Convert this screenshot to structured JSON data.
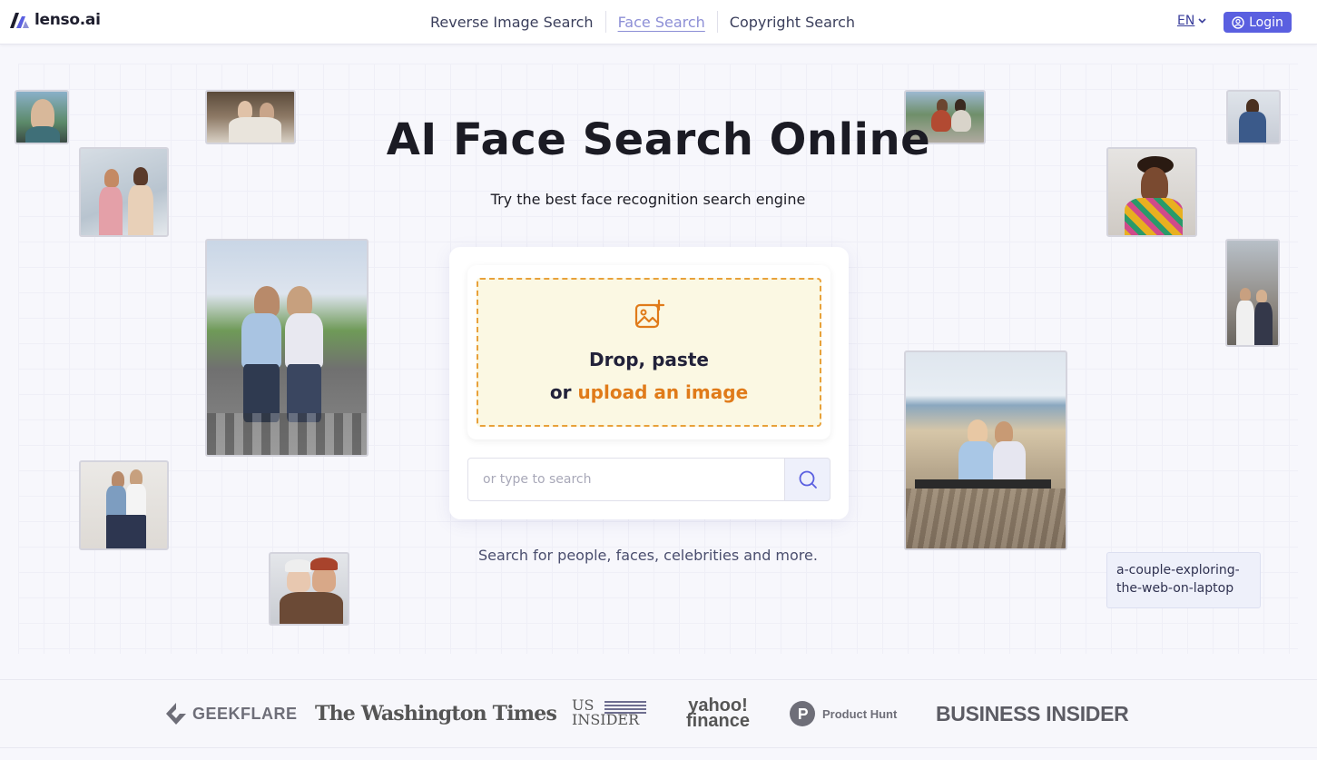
{
  "header": {
    "brand": "lenso.ai",
    "nav": [
      {
        "label": "Reverse Image Search",
        "active": false
      },
      {
        "label": "Face Search",
        "active": true
      },
      {
        "label": "Copyright Search",
        "active": false
      }
    ],
    "language": "EN",
    "login_label": "Login",
    "accent_color": "#5a5fe0"
  },
  "hero": {
    "title": "AI Face Search Online",
    "subtitle": "Try the best face recognition search engine",
    "dropzone": {
      "line1": "Drop, paste",
      "line2_prefix": "or",
      "line2_link": "upload an image",
      "icon": "image-add-icon"
    },
    "search": {
      "placeholder": "or type to search",
      "value": "",
      "button_icon": "search-icon"
    },
    "tagline": "Search for people, faces, celebrities and more.",
    "example_caption": "a-couple-exploring-the-web-on-laptop"
  },
  "press": {
    "logos": [
      "GEEKFLARE",
      "The Washington Times",
      "US INSIDER",
      "yahoo! finance",
      "Product Hunt",
      "BUSINESS INSIDER"
    ]
  }
}
